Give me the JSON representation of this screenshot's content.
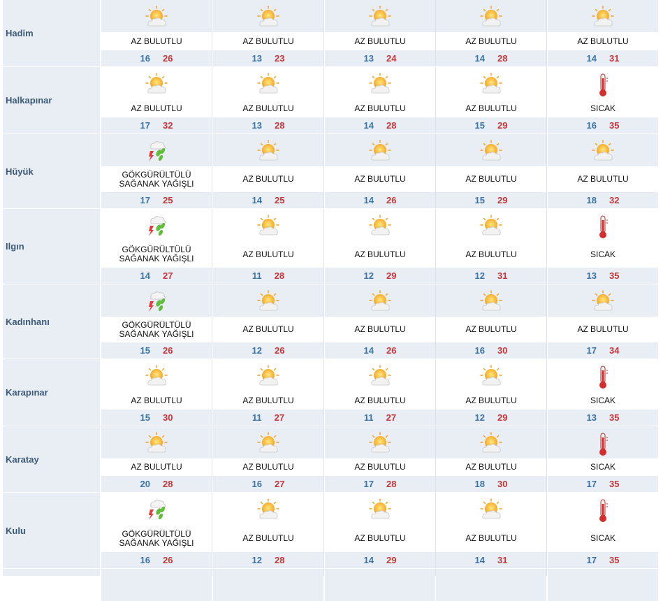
{
  "colors": {
    "min_temp": "#3a73a8",
    "max_temp": "#c4373a",
    "row_bg": "#e8eef3",
    "city_text": "#3c5a78"
  },
  "rows": [
    {
      "city": "Hadim",
      "days": [
        {
          "icon": "partly-cloudy-icon",
          "condition": "AZ BULUTLU",
          "min": "16",
          "max": "26"
        },
        {
          "icon": "partly-cloudy-icon",
          "condition": "AZ BULUTLU",
          "min": "13",
          "max": "23"
        },
        {
          "icon": "partly-cloudy-icon",
          "condition": "AZ BULUTLU",
          "min": "13",
          "max": "24"
        },
        {
          "icon": "partly-cloudy-icon",
          "condition": "AZ BULUTLU",
          "min": "14",
          "max": "28"
        },
        {
          "icon": "partly-cloudy-icon",
          "condition": "AZ BULUTLU",
          "min": "14",
          "max": "31"
        }
      ]
    },
    {
      "city": "Halkapınar",
      "days": [
        {
          "icon": "partly-cloudy-icon",
          "condition": "AZ BULUTLU",
          "min": "17",
          "max": "32"
        },
        {
          "icon": "partly-cloudy-icon",
          "condition": "AZ BULUTLU",
          "min": "13",
          "max": "28"
        },
        {
          "icon": "partly-cloudy-icon",
          "condition": "AZ BULUTLU",
          "min": "14",
          "max": "28"
        },
        {
          "icon": "partly-cloudy-icon",
          "condition": "AZ BULUTLU",
          "min": "15",
          "max": "29"
        },
        {
          "icon": "thermometer-icon",
          "condition": "SICAK",
          "min": "16",
          "max": "35"
        }
      ]
    },
    {
      "city": "Hüyük",
      "days": [
        {
          "icon": "thunderstorm-icon",
          "condition": "GÖKGÜRÜLTÜLÜ SAĞANAK YAĞIŞLI",
          "min": "17",
          "max": "25"
        },
        {
          "icon": "partly-cloudy-icon",
          "condition": "AZ BULUTLU",
          "min": "14",
          "max": "25"
        },
        {
          "icon": "partly-cloudy-icon",
          "condition": "AZ BULUTLU",
          "min": "14",
          "max": "26"
        },
        {
          "icon": "partly-cloudy-icon",
          "condition": "AZ BULUTLU",
          "min": "15",
          "max": "29"
        },
        {
          "icon": "partly-cloudy-icon",
          "condition": "AZ BULUTLU",
          "min": "18",
          "max": "32"
        }
      ]
    },
    {
      "city": "Ilgın",
      "days": [
        {
          "icon": "thunderstorm-icon",
          "condition": "GÖKGÜRÜLTÜLÜ SAĞANAK YAĞIŞLI",
          "min": "14",
          "max": "27"
        },
        {
          "icon": "partly-cloudy-icon",
          "condition": "AZ BULUTLU",
          "min": "11",
          "max": "28"
        },
        {
          "icon": "partly-cloudy-icon",
          "condition": "AZ BULUTLU",
          "min": "12",
          "max": "29"
        },
        {
          "icon": "partly-cloudy-icon",
          "condition": "AZ BULUTLU",
          "min": "12",
          "max": "31"
        },
        {
          "icon": "thermometer-icon",
          "condition": "SICAK",
          "min": "13",
          "max": "35"
        }
      ]
    },
    {
      "city": "Kadınhanı",
      "days": [
        {
          "icon": "thunderstorm-icon",
          "condition": "GÖKGÜRÜLTÜLÜ SAĞANAK YAĞIŞLI",
          "min": "15",
          "max": "26"
        },
        {
          "icon": "partly-cloudy-icon",
          "condition": "AZ BULUTLU",
          "min": "12",
          "max": "26"
        },
        {
          "icon": "partly-cloudy-icon",
          "condition": "AZ BULUTLU",
          "min": "14",
          "max": "26"
        },
        {
          "icon": "partly-cloudy-icon",
          "condition": "AZ BULUTLU",
          "min": "16",
          "max": "30"
        },
        {
          "icon": "partly-cloudy-icon",
          "condition": "AZ BULUTLU",
          "min": "17",
          "max": "34"
        }
      ]
    },
    {
      "city": "Karapınar",
      "days": [
        {
          "icon": "partly-cloudy-icon",
          "condition": "AZ BULUTLU",
          "min": "15",
          "max": "30"
        },
        {
          "icon": "partly-cloudy-icon",
          "condition": "AZ BULUTLU",
          "min": "11",
          "max": "27"
        },
        {
          "icon": "partly-cloudy-icon",
          "condition": "AZ BULUTLU",
          "min": "11",
          "max": "27"
        },
        {
          "icon": "partly-cloudy-icon",
          "condition": "AZ BULUTLU",
          "min": "12",
          "max": "29"
        },
        {
          "icon": "thermometer-icon",
          "condition": "SICAK",
          "min": "13",
          "max": "35"
        }
      ]
    },
    {
      "city": "Karatay",
      "days": [
        {
          "icon": "partly-cloudy-icon",
          "condition": "AZ BULUTLU",
          "min": "20",
          "max": "28"
        },
        {
          "icon": "partly-cloudy-icon",
          "condition": "AZ BULUTLU",
          "min": "16",
          "max": "27"
        },
        {
          "icon": "partly-cloudy-icon",
          "condition": "AZ BULUTLU",
          "min": "17",
          "max": "28"
        },
        {
          "icon": "partly-cloudy-icon",
          "condition": "AZ BULUTLU",
          "min": "18",
          "max": "30"
        },
        {
          "icon": "thermometer-icon",
          "condition": "SICAK",
          "min": "17",
          "max": "35"
        }
      ]
    },
    {
      "city": "Kulu",
      "days": [
        {
          "icon": "thunderstorm-icon",
          "condition": "GÖKGÜRÜLTÜLÜ SAĞANAK YAĞIŞLI",
          "min": "16",
          "max": "26"
        },
        {
          "icon": "partly-cloudy-icon",
          "condition": "AZ BULUTLU",
          "min": "12",
          "max": "28"
        },
        {
          "icon": "partly-cloudy-icon",
          "condition": "AZ BULUTLU",
          "min": "14",
          "max": "29"
        },
        {
          "icon": "partly-cloudy-icon",
          "condition": "AZ BULUTLU",
          "min": "14",
          "max": "31"
        },
        {
          "icon": "thermometer-icon",
          "condition": "SICAK",
          "min": "17",
          "max": "35"
        }
      ]
    }
  ]
}
